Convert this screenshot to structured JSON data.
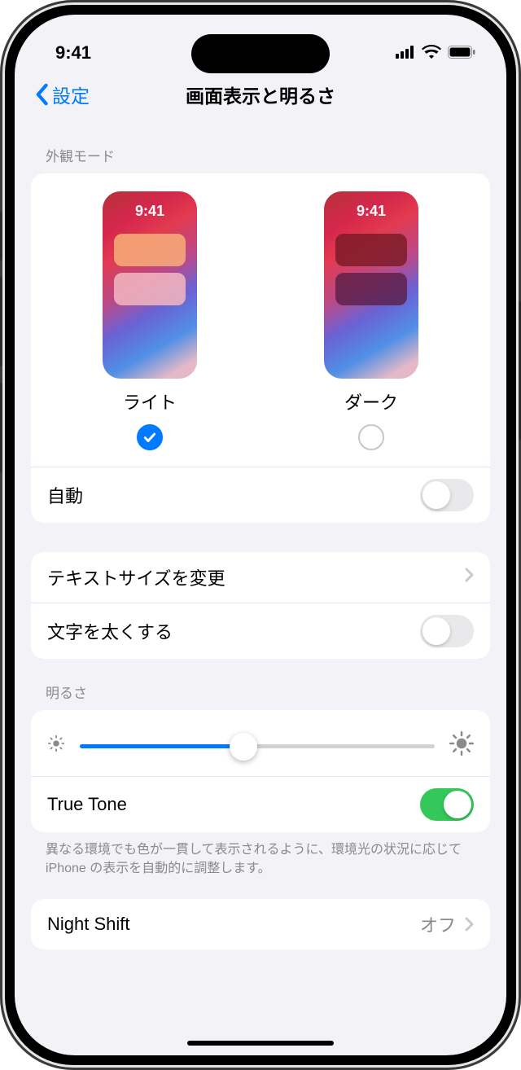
{
  "status": {
    "time": "9:41"
  },
  "nav": {
    "back": "設定",
    "title": "画面表示と明るさ"
  },
  "appearance": {
    "header": "外観モード",
    "thumb_time": "9:41",
    "light_label": "ライト",
    "dark_label": "ダーク",
    "selected": "light",
    "auto_label": "自動",
    "auto_on": false
  },
  "text": {
    "text_size_label": "テキストサイズを変更",
    "bold_label": "文字を太くする",
    "bold_on": false
  },
  "brightness": {
    "header": "明るさ",
    "value_pct": 46,
    "truetone_label": "True Tone",
    "truetone_on": true,
    "truetone_footer": "異なる環境でも色が一貫して表示されるように、環境光の状況に応じて iPhone の表示を自動的に調整します。"
  },
  "nightshift": {
    "label": "Night Shift",
    "value": "オフ"
  }
}
